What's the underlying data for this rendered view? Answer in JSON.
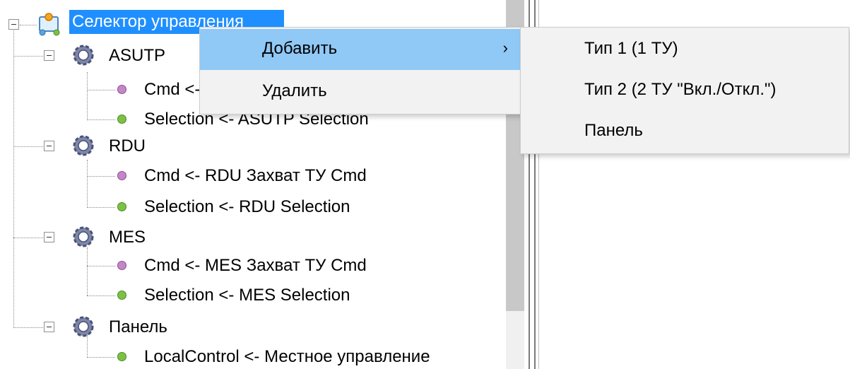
{
  "tree": {
    "root": {
      "label": "Селектор управления",
      "icon": "selector-node-icon"
    },
    "groups": [
      {
        "label": "ASUTP",
        "children": [
          {
            "label": "Cmd <- ASUTP Захват ТУ Cmd",
            "dot": "purple"
          },
          {
            "label": "Selection <- ASUTP Selection",
            "dot": "green"
          }
        ]
      },
      {
        "label": "RDU",
        "children": [
          {
            "label": "Cmd <- RDU Захват ТУ Cmd",
            "dot": "purple"
          },
          {
            "label": "Selection <- RDU Selection",
            "dot": "green"
          }
        ]
      },
      {
        "label": "MES",
        "children": [
          {
            "label": "Cmd <- MES Захват ТУ Cmd",
            "dot": "purple"
          },
          {
            "label": "Selection <- MES Selection",
            "dot": "green"
          }
        ]
      },
      {
        "label": "Панель",
        "children": [
          {
            "label": "LocalControl <- Местное управление",
            "dot": "green"
          }
        ]
      }
    ]
  },
  "context_menu": {
    "items": [
      {
        "label": "Добавить",
        "submenu_arrow": "›"
      },
      {
        "label": "Удалить"
      }
    ]
  },
  "submenu": {
    "items": [
      {
        "label": "Тип 1 (1 ТУ)"
      },
      {
        "label": "Тип 2 (2 ТУ \"Вкл./Откл.\")"
      },
      {
        "label": "Панель"
      }
    ]
  },
  "colors": {
    "selection": "#1f8fff",
    "menu_highlight": "#90c8f6",
    "menu_bg": "#f2f2f2"
  }
}
